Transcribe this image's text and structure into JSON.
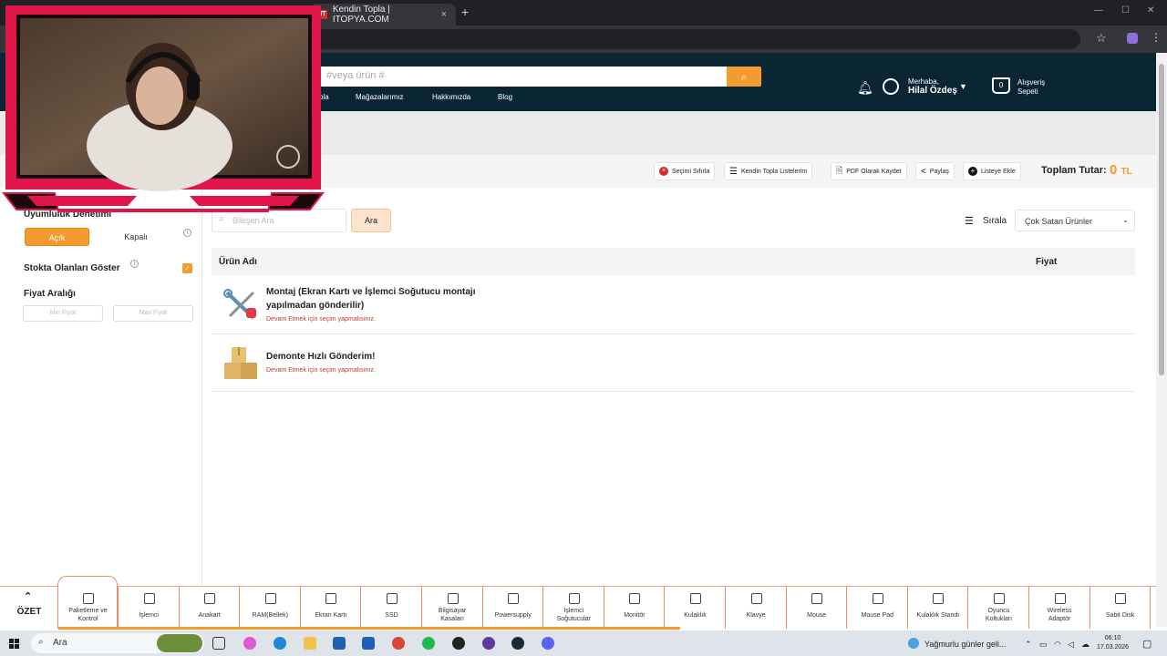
{
  "browser": {
    "tab_title": "Kendin Topla | ITOPYA.COM",
    "tab_favicon": "IT",
    "new_tab": "+",
    "close_tab": "×",
    "window_controls": [
      "—",
      "☐",
      "✕"
    ]
  },
  "header": {
    "search_placeholder": "#veya ürün #",
    "nav": [
      "pla",
      "Mağazalarımız",
      "Hakkımızda",
      "Blog"
    ],
    "greeting": "Merhaba,",
    "username": "Hilal Özdeş",
    "cart_count": "0",
    "cart_line1": "Alışveriş",
    "cart_line2": "Sepeti"
  },
  "toolbar": {
    "reset": "Seçimi Sıfırla",
    "list": "Kendin Topla Listelerim",
    "pdf": "PDF Olarak Kaydet",
    "share": "Paylaş",
    "add_list": "Listeye Ekle",
    "total_label": "Toplam Tutar:",
    "total_value": "0",
    "currency": "TL"
  },
  "sidebar": {
    "compat_label": "Uyumluluk Denetimi",
    "on_label": "Açık",
    "off_label": "Kapalı",
    "stock_label": "Stokta Olanları Göster",
    "price_label": "Fiyat Aralığı",
    "min_placeholder": "Min Fiyat",
    "max_placeholder": "Max Fiyat"
  },
  "main": {
    "component_search_placeholder": "Bileşen Ara",
    "search_button": "Ara",
    "sort_label": "Sırala",
    "sort_value": "Çok Satan Ürünler",
    "col_name": "Ürün Adı",
    "col_price": "Fiyat",
    "products": [
      {
        "name": "Montaj (Ekran Kartı ve İşlemci Soğutucu montajı",
        "name2": "yapılmadan gönderilir)",
        "warning": "Devam Etmek için seçim yapmalısınız."
      },
      {
        "name": "Demonte Hızlı Gönderim!",
        "name2": "",
        "warning": "Devam Etmek için seçim yapmalısınız."
      }
    ]
  },
  "categories": {
    "summary": "ÖZET",
    "items": [
      [
        "Paketleme ve",
        "Kontrol"
      ],
      [
        "İşlemci",
        ""
      ],
      [
        "Anakart",
        ""
      ],
      [
        "RAM(Bellek)",
        ""
      ],
      [
        "Ekran Kartı",
        ""
      ],
      [
        "SSD",
        ""
      ],
      [
        "Bilgisayar",
        "Kasaları"
      ],
      [
        "Powersupply",
        ""
      ],
      [
        "İşlemci",
        "Soğutucular"
      ],
      [
        "Monitör",
        ""
      ],
      [
        "Kulaklık",
        ""
      ],
      [
        "Klavye",
        ""
      ],
      [
        "Mouse",
        ""
      ],
      [
        "Mouse Pad",
        ""
      ],
      [
        "Kulaklık Standı",
        ""
      ],
      [
        "Oyuncu",
        "Koltukları"
      ],
      [
        "Wireless",
        "Adaptör"
      ],
      [
        "Sabit Disk",
        ""
      ]
    ]
  },
  "taskbar": {
    "search": "Ara",
    "weather": "Yağmurlu günler geli...",
    "time": "06:10",
    "date": "17.03.2026"
  },
  "colors": {
    "accent": "#f39c2d",
    "header_bg": "#0a2633",
    "warning": "#c0392b",
    "webcam_frame": "#e0164a"
  }
}
